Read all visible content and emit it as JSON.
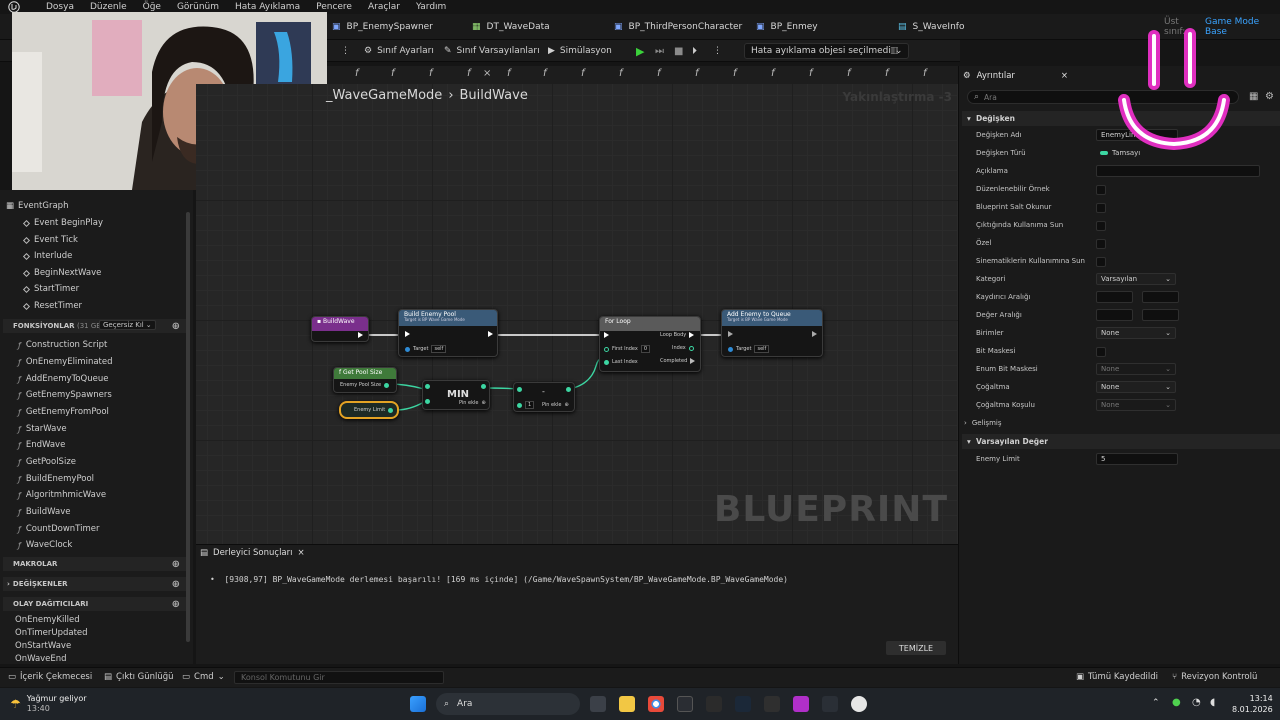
{
  "menu": [
    "Dosya",
    "Düzenle",
    "Öğe",
    "Görünüm",
    "Hata Ayıklama",
    "Pencere",
    "Araçlar",
    "Yardım"
  ],
  "file_tabs": [
    "BP_EnemySpawner",
    "DT_WaveData",
    "BP_ThirdPersonCharacter",
    "BP_Enmey",
    "S_WaveInfo"
  ],
  "top_right": {
    "parent_label": "Üst sınıf:",
    "parent_value": "Game Mode Base"
  },
  "toolbar": {
    "class_settings": "Sınıf Ayarları",
    "class_defaults": "Sınıf Varsayılanları",
    "simulation": "Simülasyon",
    "debug_dropdown": "Hata ayıklama objesi seçilmedi"
  },
  "graph": {
    "breadcrumb_parent": "_WaveGameMode",
    "breadcrumb_child": "BuildWave",
    "zoom": "Yakınlaştırma -3",
    "watermark": "BLUEPRINT",
    "nodes": {
      "entry": "BuildWave",
      "build_pool": {
        "title": "Build Enemy Pool",
        "sub": "Target is BP Wave Game Mode",
        "pin_target": "Target",
        "pin_self": "self"
      },
      "for_loop": {
        "title": "For Loop",
        "first": "First Index",
        "first_val": "0",
        "last": "Last Index",
        "loop_body": "Loop Body",
        "index": "Index",
        "completed": "Completed"
      },
      "add_queue": {
        "title": "Add Enemy to Queue",
        "sub": "Target is BP Wave Game Mode",
        "pin_target": "Target",
        "pin_self": "self"
      },
      "get_pool": {
        "title": "Get Pool Size",
        "pin": "Enemy Pool Size"
      },
      "enemy_limit": "Enemy Limit",
      "min": {
        "title": "MIN",
        "add": "Pin ekle"
      },
      "minus": {
        "title": "-",
        "val": "1",
        "add": "Pin ekle"
      }
    }
  },
  "left": {
    "graph_root": "EventGraph",
    "events": [
      "Event BeginPlay",
      "Event Tick",
      "Interlude",
      "BeginNextWave",
      "StartTimer",
      "ResetTimer"
    ],
    "functions_header": "FONKSİYONLAR",
    "functions_count": "(31 GEÇER",
    "functions_filter": "Geçersiz Kıl",
    "functions": [
      "Construction Script",
      "OnEnemyEliminated",
      "AddEnemyToQueue",
      "GetEnemySpawners",
      "GetEnemyFromPool",
      "StarWave",
      "EndWave",
      "GetPoolSize",
      "BuildEnemyPool",
      "AlgoritmhmicWave",
      "BuildWave",
      "CountDownTimer",
      "WaveClock"
    ],
    "macros": "MAKROLAR",
    "variables": "DEĞİŞKENLER",
    "dispatchers": "OLAY DAĞITICILARI",
    "dispatcher_items": [
      "OnEnemyKilled",
      "OnTimerUpdated",
      "OnStartWave",
      "OnWaveEnd"
    ]
  },
  "details": {
    "tab": "Ayrıntılar",
    "search_placeholder": "Ara",
    "section_var": "Değişken",
    "rows": {
      "name_label": "Değişken Adı",
      "name_value": "EnemyLimit",
      "type_label": "Değişken Türü",
      "type_value": "Tamsayı",
      "desc_label": "Açıklama",
      "editable": "Düzenlenebilir Örnek",
      "readonly": "Blueprint Salt Okunur",
      "expose": "Çıktığında Kullanıma Sun",
      "private": "Özel",
      "cinematic": "Sinematiklerin Kullanımına Sun",
      "category_label": "Kategori",
      "category_value": "Varsayılan",
      "slider_label": "Kaydırıcı Aralığı",
      "value_label": "Değer Aralığı",
      "units_label": "Birimler",
      "units_value": "None",
      "bitmask": "Bit Maskesi",
      "enum_label": "Enum Bit Maskesi",
      "enum_value": "None",
      "rep_label": "Çoğaltma",
      "rep_value": "None",
      "repcond_label": "Çoğaltma Koşulu",
      "repcond_value": "None",
      "advanced": "Gelişmiş"
    },
    "section_default": "Varsayılan Değer",
    "default_label": "Enemy Limit",
    "default_value": "5"
  },
  "compiler": {
    "tab": "Derleyici Sonuçları",
    "message": "[9308,97] BP_WaveGameMode derlemesi başarılı! [169 ms içinde] (/Game/WaveSpawnSystem/BP_WaveGameMode.BP_WaveGameMode)",
    "clear": "TEMİZLE"
  },
  "status": {
    "content_drawer": "İçerik Çekmecesi",
    "output_log": "Çıktı Günlüğü",
    "cmd": "Cmd",
    "console_placeholder": "Konsol Komutunu Gir",
    "save_all": "Tümü Kaydedildi",
    "revision": "Revizyon Kontrolü"
  },
  "taskbar": {
    "weather": "Yağmur geliyor",
    "weather_time": "13:40",
    "search": "Ara",
    "clock": "13:14",
    "date": "8.01.2026"
  }
}
